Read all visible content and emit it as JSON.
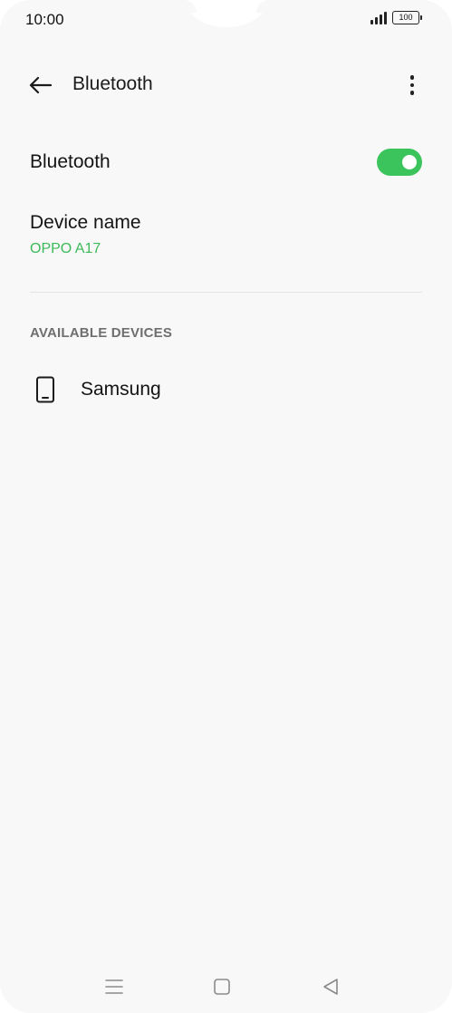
{
  "status_bar": {
    "time": "10:00",
    "battery": "100"
  },
  "app_bar": {
    "title": "Bluetooth"
  },
  "bluetooth_toggle": {
    "label": "Bluetooth",
    "enabled": true,
    "on_color": "#3cc45c"
  },
  "device_name": {
    "label": "Device name",
    "value": "OPPO A17",
    "value_color": "#3cb95a"
  },
  "available_devices": {
    "header": "AVAILABLE DEVICES",
    "items": [
      {
        "label": "Samsung",
        "icon": "phone-icon"
      }
    ]
  },
  "nav_bar": {
    "icons": [
      "menu-icon",
      "home-icon",
      "back-triangle-icon"
    ]
  }
}
